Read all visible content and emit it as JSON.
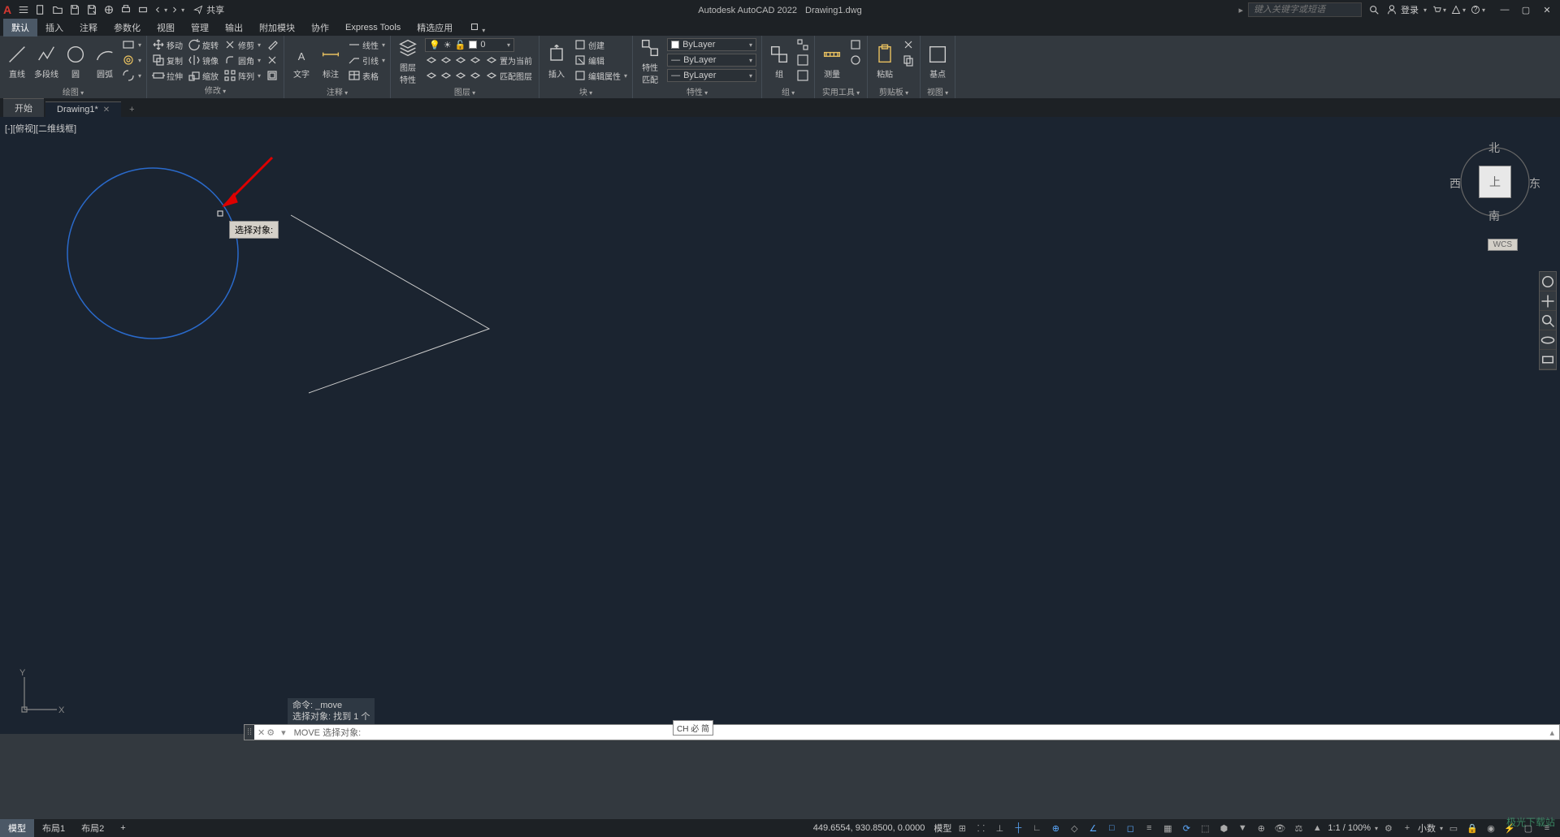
{
  "app": {
    "name": "Autodesk AutoCAD 2022",
    "file": "Drawing1.dwg"
  },
  "qat": {
    "share": "共享"
  },
  "search": {
    "placeholder": "键入关键字或短语"
  },
  "account": {
    "login": "登录"
  },
  "menu": {
    "tabs": [
      "默认",
      "插入",
      "注释",
      "参数化",
      "视图",
      "管理",
      "输出",
      "附加模块",
      "协作",
      "Express Tools",
      "精选应用"
    ]
  },
  "ribbon": {
    "draw": {
      "title": "绘图",
      "line": "直线",
      "polyline": "多段线",
      "circle": "圆",
      "arc": "圆弧"
    },
    "modify": {
      "title": "修改",
      "move": "移动",
      "copy": "复制",
      "stretch": "拉伸",
      "rotate": "旋转",
      "mirror": "镜像",
      "scale": "缩放",
      "trim": "修剪",
      "fillet": "圆角",
      "array": "阵列"
    },
    "annotation": {
      "title": "注释",
      "text": "文字",
      "dim": "标注",
      "linetype": "线性",
      "leader": "引线",
      "table": "表格"
    },
    "layers": {
      "title": "图层",
      "props": "图层\n特性",
      "current": "0",
      "setcurrent": "置为当前",
      "match": "匹配图层"
    },
    "block": {
      "title": "块",
      "insert": "插入",
      "create": "创建",
      "edit": "编辑",
      "editattr": "编辑属性"
    },
    "properties": {
      "title": "特性",
      "match": "特性\n匹配",
      "bylayer": "ByLayer"
    },
    "group": {
      "title": "组",
      "group": "组"
    },
    "utilities": {
      "title": "实用工具",
      "measure": "测量"
    },
    "clipboard": {
      "title": "剪贴板",
      "paste": "粘贴"
    },
    "view": {
      "title": "视图",
      "base": "基点"
    }
  },
  "tabs": {
    "start": "开始",
    "drawing": "Drawing1*"
  },
  "viewport": {
    "label": "[-][俯视][二维线框]"
  },
  "tooltip": {
    "text": "选择对象:"
  },
  "viewcube": {
    "n": "北",
    "s": "南",
    "e": "东",
    "w": "西",
    "top": "上"
  },
  "wcs": "WCS",
  "cmd": {
    "history1": "命令: _move",
    "history2": "选择对象: 找到 1 个",
    "prompt": "MOVE 选择对象:"
  },
  "ime": "CH 必 简",
  "status": {
    "model": "模型",
    "layout1": "布局1",
    "layout2": "布局2",
    "coords": "449.6554, 930.8500, 0.0000",
    "modelspace": "模型",
    "scale": "1:1 / 100%",
    "decimal": "小数"
  },
  "watermark": "极光下载站"
}
